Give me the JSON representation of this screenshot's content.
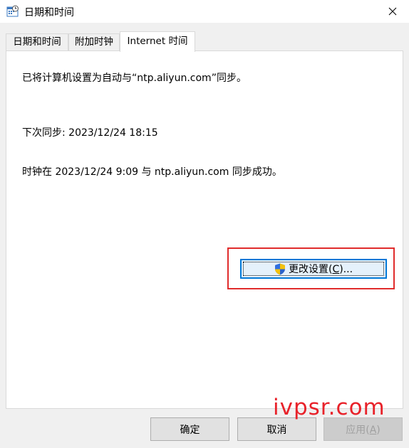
{
  "window": {
    "title": "日期和时间",
    "icon": "clock-calendar-icon",
    "close_icon": "close-icon"
  },
  "tabs": [
    {
      "label": "日期和时间",
      "active": false
    },
    {
      "label": "附加时钟",
      "active": false
    },
    {
      "label": "Internet 时间",
      "active": true
    }
  ],
  "content": {
    "status_line": "已将计算机设置为自动与“ntp.aliyun.com”同步。",
    "next_sync": "下次同步: 2023/12/24 18:15",
    "last_sync": "时钟在 2023/12/24 9:09 与 ntp.aliyun.com 同步成功。"
  },
  "change_settings_button": {
    "label_prefix": "更改设置(",
    "label_accel": "C",
    "label_suffix": ")...",
    "icon": "uac-shield-icon"
  },
  "footer": {
    "ok": "确定",
    "cancel": "取消",
    "apply_prefix": "应用(",
    "apply_accel": "A",
    "apply_suffix": ")"
  },
  "watermark": "ivpsr.com",
  "colors": {
    "focus_blue": "#0078d7",
    "highlight_red": "#e02c2c",
    "watermark_red": "#e8222a"
  }
}
